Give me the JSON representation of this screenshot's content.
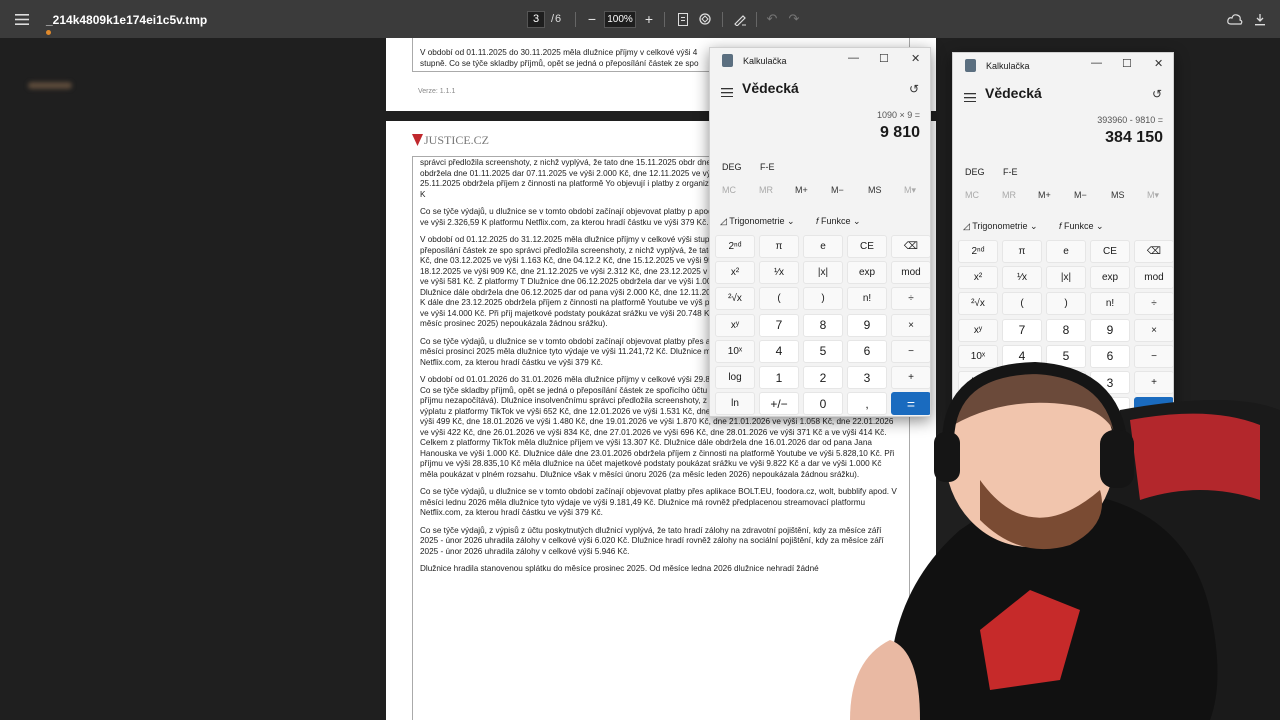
{
  "viewer": {
    "filename": "_214k4809k1e174ei1c5v.tmp",
    "current_page": "3",
    "page_sep": "/",
    "total_pages": "6",
    "zoom": "100%",
    "menu_icon": "hamburger-icon",
    "icons": [
      "minus-icon",
      "plus-icon",
      "fit-page-icon",
      "rotate-icon",
      "draw-icon",
      "undo-icon",
      "redo-icon",
      "cloud-icon",
      "download-icon",
      "print-icon"
    ]
  },
  "doc": {
    "prev_page_lines": [
      "V období od 01.11.2025 do 30.11.2025 měla dlužnice příjmy v celkové výši 4",
      "stupně. Co se týče skladby příjmů, opět se jedná o přeposílání částek ze spo"
    ],
    "version": "Verze: 1.1.1",
    "logo": "JUSTICE.CZ",
    "paragraphs": [
      "správci předložila screenshoty, z nichž vyplývá, že tato dne 15.11.2025 obdr dne 30.11.2025 ve výši 2.762 Kč. Dlužnice dále obdržela dne 01.11.2025 dar 07.11.2025 ve výši 2.000 Kč, dne 12.11.2025 ve výši 3.000 Kč, dne 21.11.2025 Kč. Dlužnice dále dne 25.11.2025 obdržela příjem z činnosti na platformě Yo objevují i platby z organizace Red Face, a to dne 26.11.2025 ve výši 14.000 K",
      "Co se týče výdajů, u dlužnice se v tomto období začínají objevovat platby p apod. V měsíci listopadu 2025 měla dlužnice tyto výdaje ve výši 2.326,59 K platformu Netflix.com, za kterou hradí částku ve výši 379 Kč.",
      "V období od 01.12.2025 do 31.12.2025 měla dlužnice příjmy v celkové výši stupně. Co se týče skladby příjmů, opět se jedná o přeposílání částek ze spo správci předložila screenshoty, z nichž vyplývá, že tato dne 01.12.2025 obdr dne 02.12.2025 ve výši 423 Kč, dne 03.12.2025 ve výši 1.163 Kč, dne 04.12.2 Kč, dne 15.12.2025 ve výši 958 Kč a ve výši 783 Kč, dne 16.12.2025 ve výši 2 18.12.2025 ve výši 909 Kč, dne 21.12.2025 ve výši 2.312 Kč, dne 23.12.2025 v dne 29.12.2025 ve výši 553 Kč a dne 30.12.2025 ve výši 581 Kč. Z platformy T Dlužnice dne 06.12.2025 obdržela dar ve výši 1.000 Kč od pana Petra Hanáč od pana Jana Cikána. Dlužnice dále obdržela dne 06.12.2025 dar od pana výši 2.000 Kč, dne 12.11.2025 ve výši 3.000 Kč, dne 21.11.2025 ve výši 2.000 K dále dne 23.12.2025 obdržela příjem z činnosti na platformě Youtube ve výš platby z organizace Red Face, a to dne 29.12.2025 ve výši 14.000 Kč. Při příj majetkové podstaty poukázat srážku ve výši 20.748 Kč a dary ve výši 12.500 v měsíci lednu 2026 (za měsíc prosinec 2025) nepoukázala žádnou srážku).",
      "Co se týče výdajů, u dlužnice se v tomto období začínají objevovat platby přes aplikace BOLT.EU, foodora.cz, wolt, bubblify apod. V měsíci prosinci 2025 měla dlužnice tyto výdaje ve výši 11.241,72 Kč. Dlužnice má rovněž předplacenou streamovací platformu Netflix.com, za kterou hradí částku ve výši 379 Kč.",
      "V období od 01.01.2026 do 31.01.2026 měla dlužnice příjmy v celkové výši 29.835,10 Kč, a to včetně invalidního důchodu I. stupně. Co se týče skladby příjmů, opět se jedná o přeposílání částek ze spořicího účtu dlužnice (tyto insolvenční správce do celkového příjmu nezapočítává). Dlužnice insolvenčnímu správci předložila screenshoty, z nichž vyplývá, že tato dne 07.01.2026 obdržela výplatu z platformy TikTok ve výši 652 Kč, dne 12.01.2026 ve výši 1.531 Kč, dne 13.01.2026 ve výši 3.480 Kč, dne 16.01.2026 ve výši 499 Kč, dne 18.01.2026 ve výši 1.480 Kč, dne 19.01.2026 ve výši 1.870 Kč, dne 21.01.2026 ve výši 1.058 Kč, dne 22.01.2026 ve výši 422 Kč, dne 26.01.2026 ve výši 834 Kč, dne 27.01.2026 ve výši 696 Kč, dne 28.01.2026 ve výši 371 Kč a ve výši 414 Kč. Celkem z platformy TikTok měla dlužnice příjem ve výši 13.307 Kč. Dlužnice dále obdržela dne 16.01.2026 dar od pana Jana Hanouska ve výši 1.000 Kč. Dlužnice dále dne 23.01.2026 obdržela příjem z činnosti na platformě Youtube ve výši 5.828,10 Kč. Při příjmu ve výši 28.835,10 Kč měla dlužnice na účet majetkové podstaty poukázat srážku ve výši 9.822 Kč a dar ve výši 1.000 Kč měla poukázat v plném rozsahu. Dlužnice však v měsíci únoru 2026 (za měsíc leden 2026) nepoukázala žádnou srážku).",
      "Co se týče výdajů, u dlužnice se v tomto období začínají objevovat platby přes aplikace BOLT.EU, foodora.cz, wolt, bubblify apod. V měsíci lednu 2026 měla dlužnice tyto výdaje ve výši 9.181,49 Kč. Dlužnice má rovněž předplacenou streamovací platformu Netflix.com, za kterou hradí částku ve výši 379 Kč.",
      "Co se týče výdajů, z výpisů z účtu poskytnutých dlužnicí vyplývá, že tato hradí zálohy na zdravotní pojištění, kdy za měsíce září 2025 - únor 2026 uhradila zálohy v celkové výši 6.020 Kč. Dlužnice hradí rovněž zálohy na sociální pojištění, kdy za měsíce září 2025 - únor 2026 uhradila zálohy v celkové výši 5.946 Kč.",
      "Dlužnice hradila stanovenou splátku do měsíce prosinec 2025. Od měsíce ledna 2026 dlužnice nehradí žádné"
    ]
  },
  "calc1": {
    "app_name": "Kalkulačka",
    "mode": "Vědecká",
    "expression": "1090 × 9 =",
    "result": "9 810"
  },
  "calc2": {
    "app_name": "Kalkulačka",
    "mode": "Vědecká",
    "expression": "393960 - 9810 =",
    "result": "384 150"
  },
  "calc_common": {
    "angle": "DEG",
    "fe": "F-E",
    "memory": [
      "MC",
      "MR",
      "M+",
      "M−",
      "MS",
      "M▾"
    ],
    "trig": "Trigonometrie",
    "func": "Funkce",
    "keys": [
      [
        "2ⁿᵈ",
        "π",
        "e",
        "CE",
        "⌫"
      ],
      [
        "x²",
        "¹⁄x",
        "|x|",
        "exp",
        "mod"
      ],
      [
        "²√x",
        "(",
        ")",
        "n!",
        "÷"
      ],
      [
        "xʸ",
        "7",
        "8",
        "9",
        "×"
      ],
      [
        "10ˣ",
        "4",
        "5",
        "6",
        "−"
      ],
      [
        "log",
        "1",
        "2",
        "3",
        "+"
      ],
      [
        "ln",
        "+/−",
        "0",
        ",",
        "="
      ]
    ]
  }
}
